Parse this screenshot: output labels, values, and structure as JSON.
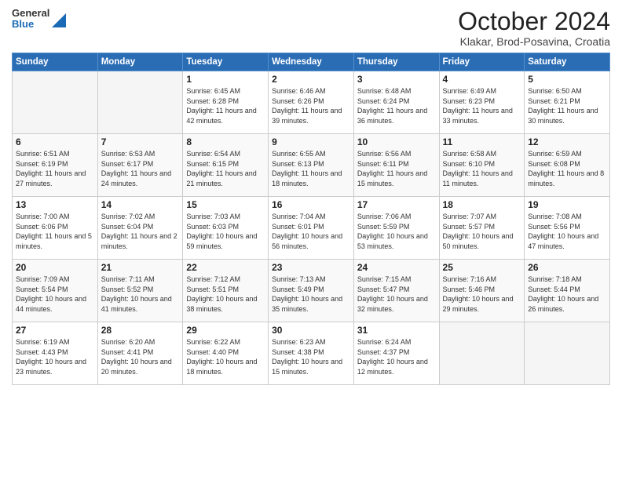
{
  "header": {
    "logo": {
      "general": "General",
      "blue": "Blue"
    },
    "title": "October 2024",
    "location": "Klakar, Brod-Posavina, Croatia"
  },
  "calendar": {
    "days": [
      "Sunday",
      "Monday",
      "Tuesday",
      "Wednesday",
      "Thursday",
      "Friday",
      "Saturday"
    ],
    "weeks": [
      [
        {
          "day": "",
          "sunrise": "",
          "sunset": "",
          "daylight": "",
          "empty": true
        },
        {
          "day": "",
          "sunrise": "",
          "sunset": "",
          "daylight": "",
          "empty": true
        },
        {
          "day": "1",
          "sunrise": "Sunrise: 6:45 AM",
          "sunset": "Sunset: 6:28 PM",
          "daylight": "Daylight: 11 hours and 42 minutes."
        },
        {
          "day": "2",
          "sunrise": "Sunrise: 6:46 AM",
          "sunset": "Sunset: 6:26 PM",
          "daylight": "Daylight: 11 hours and 39 minutes."
        },
        {
          "day": "3",
          "sunrise": "Sunrise: 6:48 AM",
          "sunset": "Sunset: 6:24 PM",
          "daylight": "Daylight: 11 hours and 36 minutes."
        },
        {
          "day": "4",
          "sunrise": "Sunrise: 6:49 AM",
          "sunset": "Sunset: 6:23 PM",
          "daylight": "Daylight: 11 hours and 33 minutes."
        },
        {
          "day": "5",
          "sunrise": "Sunrise: 6:50 AM",
          "sunset": "Sunset: 6:21 PM",
          "daylight": "Daylight: 11 hours and 30 minutes."
        }
      ],
      [
        {
          "day": "6",
          "sunrise": "Sunrise: 6:51 AM",
          "sunset": "Sunset: 6:19 PM",
          "daylight": "Daylight: 11 hours and 27 minutes."
        },
        {
          "day": "7",
          "sunrise": "Sunrise: 6:53 AM",
          "sunset": "Sunset: 6:17 PM",
          "daylight": "Daylight: 11 hours and 24 minutes."
        },
        {
          "day": "8",
          "sunrise": "Sunrise: 6:54 AM",
          "sunset": "Sunset: 6:15 PM",
          "daylight": "Daylight: 11 hours and 21 minutes."
        },
        {
          "day": "9",
          "sunrise": "Sunrise: 6:55 AM",
          "sunset": "Sunset: 6:13 PM",
          "daylight": "Daylight: 11 hours and 18 minutes."
        },
        {
          "day": "10",
          "sunrise": "Sunrise: 6:56 AM",
          "sunset": "Sunset: 6:11 PM",
          "daylight": "Daylight: 11 hours and 15 minutes."
        },
        {
          "day": "11",
          "sunrise": "Sunrise: 6:58 AM",
          "sunset": "Sunset: 6:10 PM",
          "daylight": "Daylight: 11 hours and 11 minutes."
        },
        {
          "day": "12",
          "sunrise": "Sunrise: 6:59 AM",
          "sunset": "Sunset: 6:08 PM",
          "daylight": "Daylight: 11 hours and 8 minutes."
        }
      ],
      [
        {
          "day": "13",
          "sunrise": "Sunrise: 7:00 AM",
          "sunset": "Sunset: 6:06 PM",
          "daylight": "Daylight: 11 hours and 5 minutes."
        },
        {
          "day": "14",
          "sunrise": "Sunrise: 7:02 AM",
          "sunset": "Sunset: 6:04 PM",
          "daylight": "Daylight: 11 hours and 2 minutes."
        },
        {
          "day": "15",
          "sunrise": "Sunrise: 7:03 AM",
          "sunset": "Sunset: 6:03 PM",
          "daylight": "Daylight: 10 hours and 59 minutes."
        },
        {
          "day": "16",
          "sunrise": "Sunrise: 7:04 AM",
          "sunset": "Sunset: 6:01 PM",
          "daylight": "Daylight: 10 hours and 56 minutes."
        },
        {
          "day": "17",
          "sunrise": "Sunrise: 7:06 AM",
          "sunset": "Sunset: 5:59 PM",
          "daylight": "Daylight: 10 hours and 53 minutes."
        },
        {
          "day": "18",
          "sunrise": "Sunrise: 7:07 AM",
          "sunset": "Sunset: 5:57 PM",
          "daylight": "Daylight: 10 hours and 50 minutes."
        },
        {
          "day": "19",
          "sunrise": "Sunrise: 7:08 AM",
          "sunset": "Sunset: 5:56 PM",
          "daylight": "Daylight: 10 hours and 47 minutes."
        }
      ],
      [
        {
          "day": "20",
          "sunrise": "Sunrise: 7:09 AM",
          "sunset": "Sunset: 5:54 PM",
          "daylight": "Daylight: 10 hours and 44 minutes."
        },
        {
          "day": "21",
          "sunrise": "Sunrise: 7:11 AM",
          "sunset": "Sunset: 5:52 PM",
          "daylight": "Daylight: 10 hours and 41 minutes."
        },
        {
          "day": "22",
          "sunrise": "Sunrise: 7:12 AM",
          "sunset": "Sunset: 5:51 PM",
          "daylight": "Daylight: 10 hours and 38 minutes."
        },
        {
          "day": "23",
          "sunrise": "Sunrise: 7:13 AM",
          "sunset": "Sunset: 5:49 PM",
          "daylight": "Daylight: 10 hours and 35 minutes."
        },
        {
          "day": "24",
          "sunrise": "Sunrise: 7:15 AM",
          "sunset": "Sunset: 5:47 PM",
          "daylight": "Daylight: 10 hours and 32 minutes."
        },
        {
          "day": "25",
          "sunrise": "Sunrise: 7:16 AM",
          "sunset": "Sunset: 5:46 PM",
          "daylight": "Daylight: 10 hours and 29 minutes."
        },
        {
          "day": "26",
          "sunrise": "Sunrise: 7:18 AM",
          "sunset": "Sunset: 5:44 PM",
          "daylight": "Daylight: 10 hours and 26 minutes."
        }
      ],
      [
        {
          "day": "27",
          "sunrise": "Sunrise: 6:19 AM",
          "sunset": "Sunset: 4:43 PM",
          "daylight": "Daylight: 10 hours and 23 minutes."
        },
        {
          "day": "28",
          "sunrise": "Sunrise: 6:20 AM",
          "sunset": "Sunset: 4:41 PM",
          "daylight": "Daylight: 10 hours and 20 minutes."
        },
        {
          "day": "29",
          "sunrise": "Sunrise: 6:22 AM",
          "sunset": "Sunset: 4:40 PM",
          "daylight": "Daylight: 10 hours and 18 minutes."
        },
        {
          "day": "30",
          "sunrise": "Sunrise: 6:23 AM",
          "sunset": "Sunset: 4:38 PM",
          "daylight": "Daylight: 10 hours and 15 minutes."
        },
        {
          "day": "31",
          "sunrise": "Sunrise: 6:24 AM",
          "sunset": "Sunset: 4:37 PM",
          "daylight": "Daylight: 10 hours and 12 minutes."
        },
        {
          "day": "",
          "sunrise": "",
          "sunset": "",
          "daylight": "",
          "empty": true
        },
        {
          "day": "",
          "sunrise": "",
          "sunset": "",
          "daylight": "",
          "empty": true
        }
      ]
    ]
  }
}
